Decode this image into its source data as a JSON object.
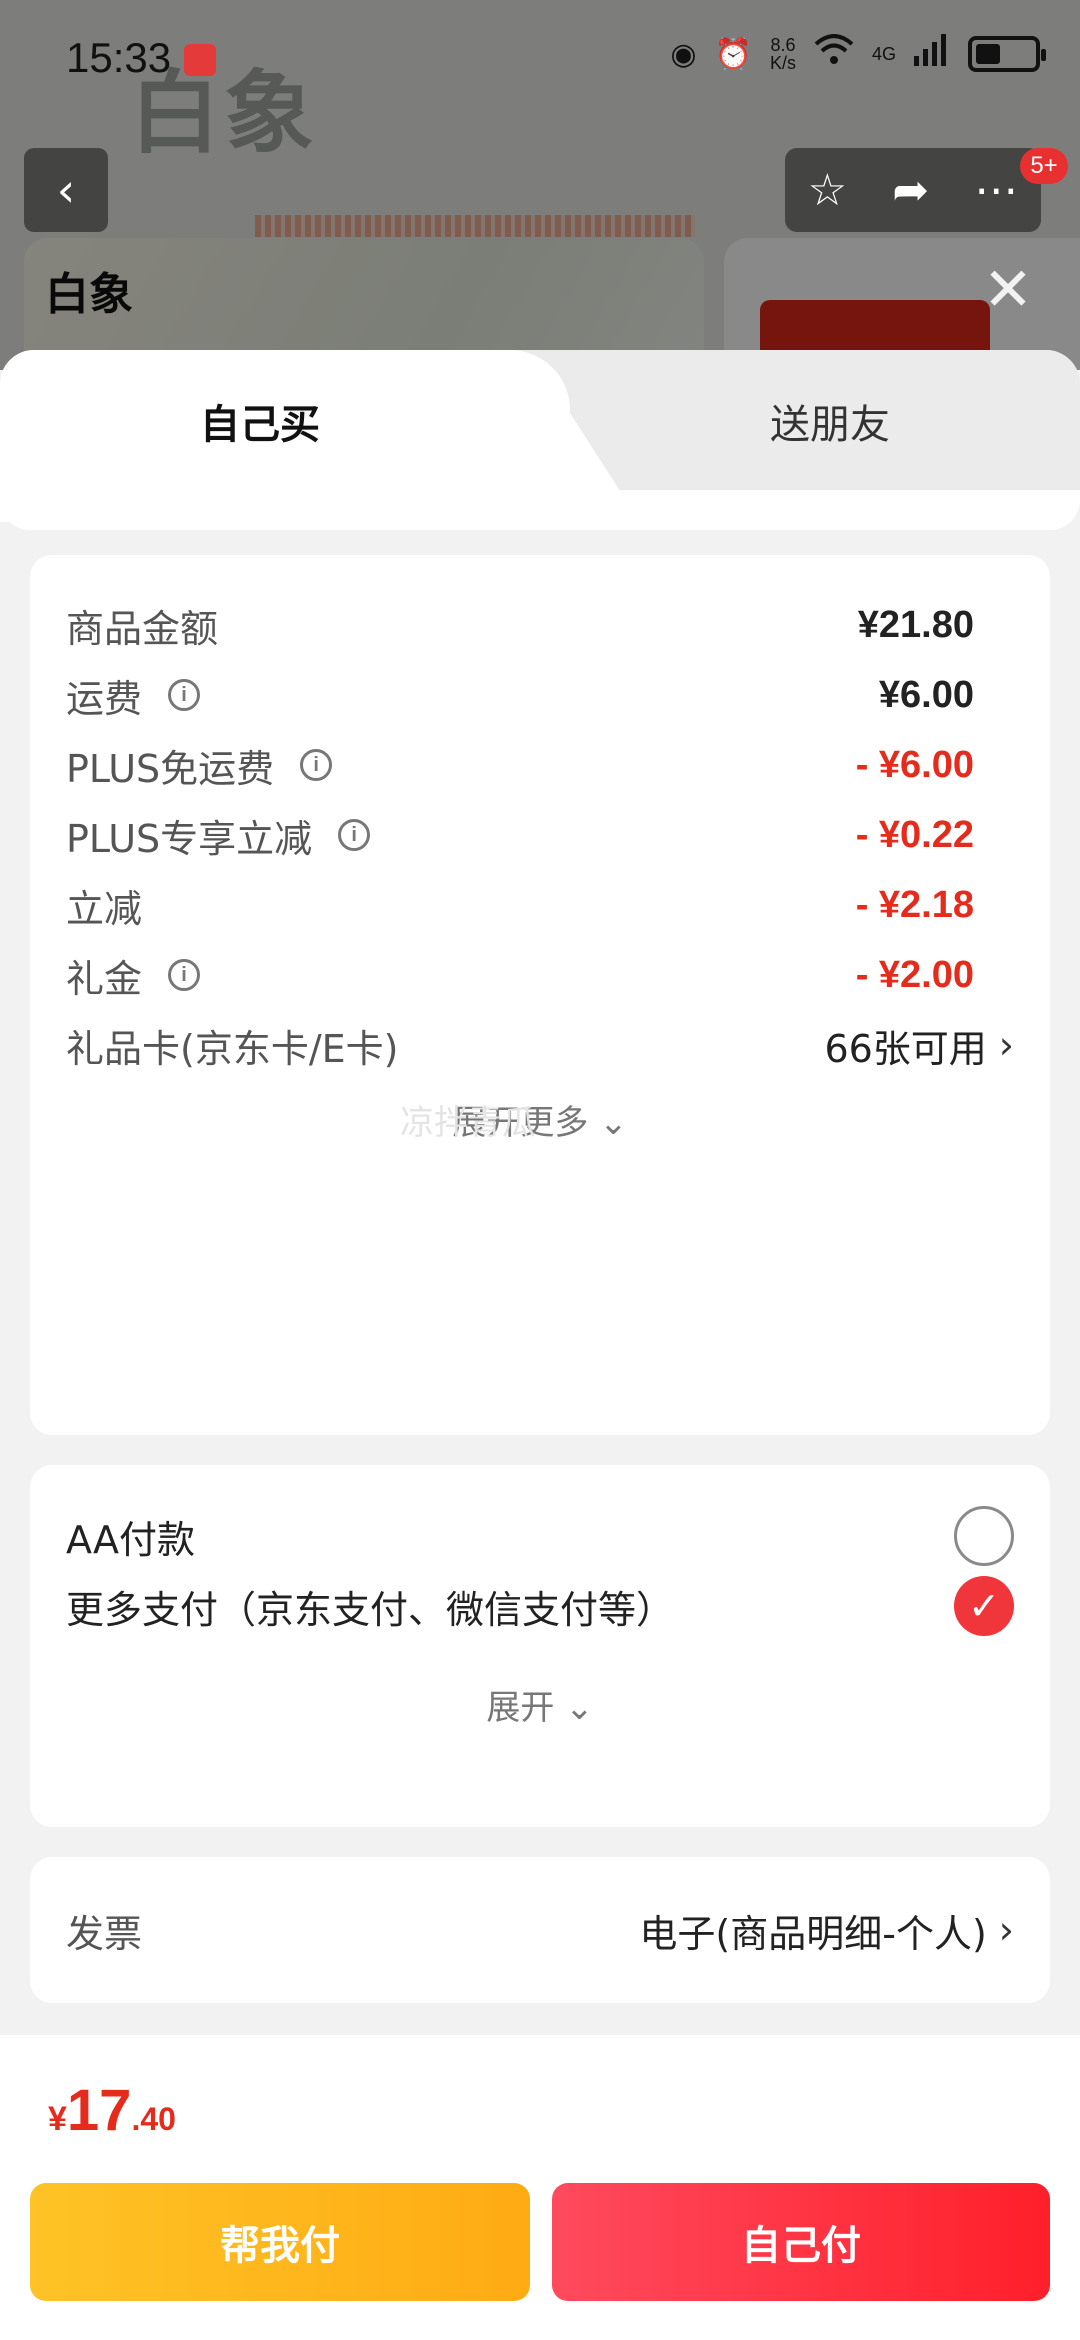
{
  "status_bar": {
    "time": "15:33",
    "net_speed_value": "8.6",
    "net_speed_unit": "K/s",
    "network": "4G"
  },
  "background": {
    "brand": "白象",
    "logo_text": "白象"
  },
  "nav": {
    "badge": "5+"
  },
  "tabs": [
    {
      "label": "自己买",
      "active": true
    },
    {
      "label": "送朋友",
      "active": false
    }
  ],
  "price_rows": [
    {
      "label": "商品金额",
      "value": "¥21.80",
      "info": false,
      "red": false
    },
    {
      "label": "运费",
      "value": "¥6.00",
      "info": true,
      "red": false
    },
    {
      "label": "PLUS免运费",
      "value": "- ¥6.00",
      "info": true,
      "red": true
    },
    {
      "label": "PLUS专享立减",
      "value": "- ¥0.22",
      "info": true,
      "red": true
    },
    {
      "label": "立减",
      "value": "- ¥2.18",
      "info": false,
      "red": true
    },
    {
      "label": "礼金",
      "value": "- ¥2.00",
      "info": true,
      "red": true
    }
  ],
  "gift_card": {
    "label": "礼品卡(京东卡/E卡)",
    "value": "66张可用"
  },
  "expand_more": "展开更多",
  "watermark": "凉拌青瓜",
  "payment": {
    "options": [
      {
        "label": "AA付款",
        "selected": false
      },
      {
        "label": "更多支付（京东支付、微信支付等）",
        "selected": true
      }
    ],
    "expand": "展开"
  },
  "invoice": {
    "label": "发票",
    "value": "电子(商品明细-个人)"
  },
  "total": {
    "currency": "¥",
    "integer": "17",
    "decimal": ".40"
  },
  "buttons": {
    "help_pay": "帮我付",
    "self_pay": "自己付"
  },
  "colors": {
    "accent_red": "#e42b1c",
    "help_pay": "#ffb81c",
    "self_pay": "#ff2d3c"
  }
}
